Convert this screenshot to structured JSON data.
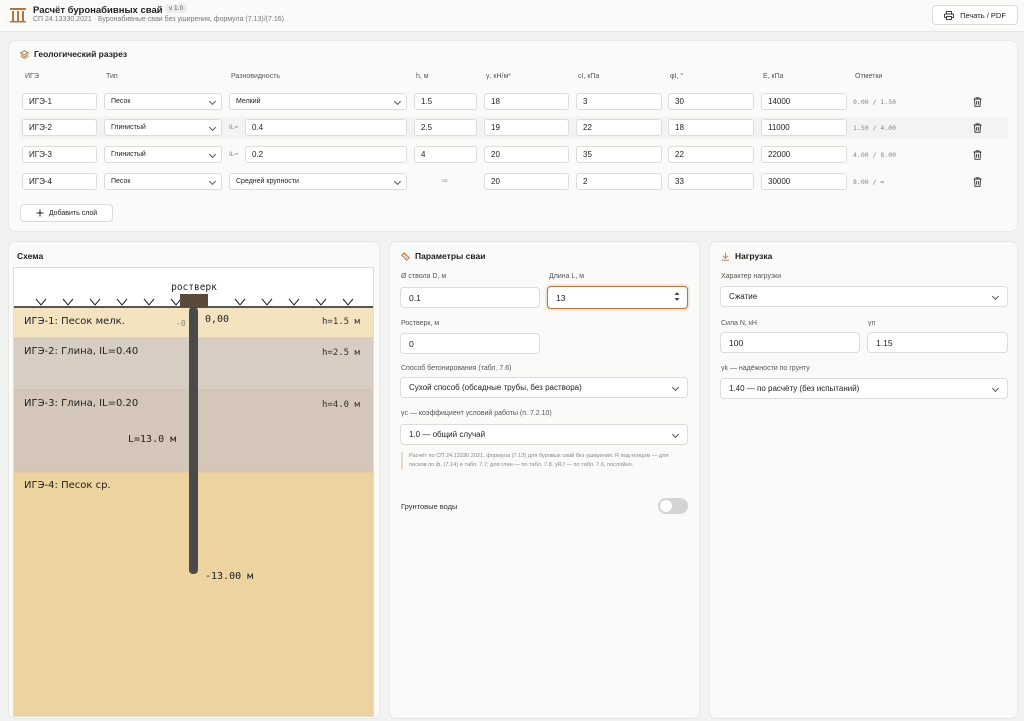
{
  "header": {
    "title": "Расчёт буронабивных свай",
    "version": "v 1.0",
    "subtitle": "СП 24.13330.2021 · Буронабивные сваи без уширения, формула (7.13)/(7.16)",
    "print_label": "Печать / PDF"
  },
  "geology": {
    "title": "Геологический разрез",
    "columns": [
      "ИГЭ",
      "Тип",
      "Разновидность",
      "h, м",
      "γ, кН/м³",
      "cI, кПа",
      "φI, °",
      "E, кПа",
      "Отметки"
    ],
    "il_prefix": "IL=",
    "rows": [
      {
        "ige": "ИГЭ-1",
        "type": "Песок",
        "variety": "Мелкий",
        "h": "1.5",
        "gamma": "18",
        "c": "3",
        "phi": "30",
        "e": "14000",
        "marks": "0.00 / 1.50"
      },
      {
        "ige": "ИГЭ-2",
        "type": "Глинистый",
        "variety": "0.4",
        "h": "2.5",
        "gamma": "19",
        "c": "22",
        "phi": "18",
        "e": "11000",
        "marks": "1.50 / 4.00"
      },
      {
        "ige": "ИГЭ-3",
        "type": "Глинистый",
        "variety": "0.2",
        "h": "4",
        "gamma": "20",
        "c": "35",
        "phi": "22",
        "e": "22000",
        "marks": "4.00 / 8.00"
      },
      {
        "ige": "ИГЭ-4",
        "type": "Песок",
        "variety": "Средней крупности",
        "h": "∞",
        "gamma": "20",
        "c": "2",
        "phi": "33",
        "e": "30000",
        "marks": "8.00 / ∞"
      }
    ],
    "add_label": "Добавить слой"
  },
  "schema": {
    "title": "Схема",
    "grillage_label": "ростверк",
    "zero_label": "0,00",
    "zero_partial": "-0",
    "length_label": "L=13.0 м",
    "bottom_label": "-13.00 м",
    "layers": [
      {
        "name": "ИГЭ-1: Песок мелк.",
        "h": "h=1.5 м",
        "color": "#f3e4bf"
      },
      {
        "name": "ИГЭ-2: Глина, IL=0.40",
        "h": "h=2.5 м",
        "color": "#d8cdc2"
      },
      {
        "name": "ИГЭ-3: Глина, IL=0.20",
        "h": "h=4.0 м",
        "color": "#d4c7ba"
      },
      {
        "name": "ИГЭ-4: Песок ср.",
        "h": "",
        "color": "#ecd39f"
      }
    ]
  },
  "pile": {
    "title": "Параметры сваи",
    "diameter_label": "Ø ствола D, м",
    "diameter_value": "0.1",
    "length_label": "Длина L, м",
    "length_value": "13",
    "grillage_label": "Ростверк, м",
    "grillage_value": "0",
    "method_label": "Способ бетонирования (табл. 7.6)",
    "method_value": "Сухой способ (обсадные трубы, без раствора)",
    "gc_label": "γc — коэффициент условий работы (п. 7.2.10)",
    "gc_value": "1.0 — общий случай",
    "note": "Расчёт по СП 24.13330.2021, формула (7.13) для буровых свай без уширения. R под концом — для песков по ф. (7.14) и табл. 7.7; для глин — по табл. 7.8. γR,f — по табл. 7.6, послойно.",
    "groundwater_label": "Грунтовые воды",
    "groundwater_on": false
  },
  "load": {
    "title": "Нагрузка",
    "character_label": "Характер нагрузки",
    "character_value": "Сжатие",
    "force_label": "Сила N, кН",
    "force_value": "100",
    "gn_label": "γn",
    "gn_value": "1.15",
    "gk_label": "γk — надёжности по грунту",
    "gk_value": "1.40 — по расчёту (без испытаний)"
  },
  "colors": {
    "accent": "#b8743a",
    "pile": "#4a4a4a",
    "grillage": "#5a4a3c"
  }
}
